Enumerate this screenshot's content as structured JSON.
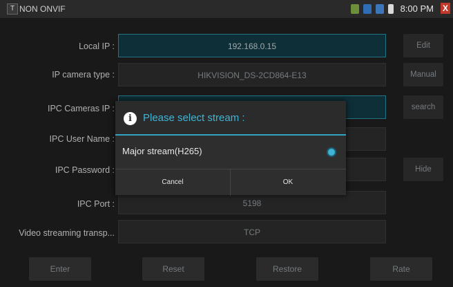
{
  "status_bar": {
    "app_title": "NON ONVIF",
    "time": "8:00 PM",
    "close": "X"
  },
  "form": {
    "local_ip": {
      "label": "Local IP :",
      "value": "192.168.0.15"
    },
    "ip_camera_type": {
      "label": "IP camera type :",
      "value": "HIKVISION_DS-2CD864-E13"
    },
    "ipc_cameras_ip": {
      "label": "IPC Cameras IP :",
      "value": ""
    },
    "ipc_user_name": {
      "label": "IPC User Name :",
      "value": ""
    },
    "ipc_password": {
      "label": "IPC Password :",
      "value": ""
    },
    "ipc_port": {
      "label": "IPC Port :",
      "value": "5198"
    },
    "video_transport": {
      "label": "Video streaming transp...",
      "value": "TCP"
    }
  },
  "side_buttons": {
    "edit": "Edit",
    "manual": "Manual",
    "search": "search",
    "hide": "Hide"
  },
  "bottom_buttons": {
    "enter": "Enter",
    "reset": "Reset",
    "restore": "Restore",
    "rate": "Rate"
  },
  "dialog": {
    "title": "Please select stream :",
    "option": "Major stream(H265)",
    "option_selected": true,
    "cancel": "Cancel",
    "ok": "OK"
  },
  "colors": {
    "accent": "#3fb5d6",
    "background": "#1f1f1f",
    "focus_field": "#123a45"
  }
}
